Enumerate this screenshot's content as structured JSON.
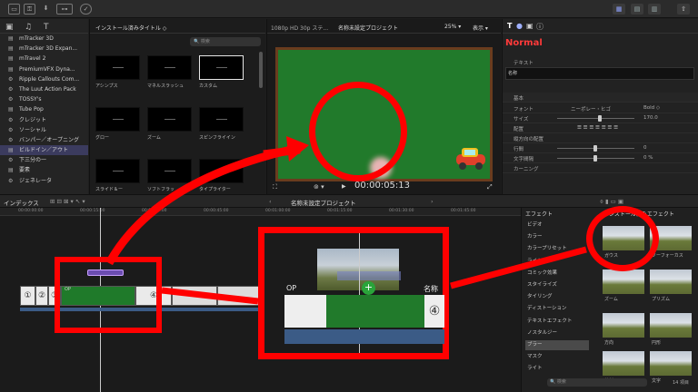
{
  "sidebar": {
    "items": [
      {
        "label": "mTracker 3D",
        "icon": "film-icon"
      },
      {
        "label": "mTracker 3D Expan...",
        "icon": "film-icon"
      },
      {
        "label": "mTravel 2",
        "icon": "film-icon"
      },
      {
        "label": "PremiumVFX Dyna...",
        "icon": "film-icon"
      },
      {
        "label": "Ripple Callouts Com...",
        "icon": "gear-icon"
      },
      {
        "label": "The Luut Action Pack",
        "icon": "gear-icon"
      },
      {
        "label": "TOSSY's",
        "icon": "gear-icon"
      },
      {
        "label": "Tube Pop",
        "icon": "film-icon"
      },
      {
        "label": "クレジット",
        "icon": "gear-icon"
      },
      {
        "label": "ソーシャル",
        "icon": "gear-icon"
      },
      {
        "label": "バンパー／オープニング",
        "icon": "gear-icon"
      },
      {
        "label": "ビルドイン／アウト",
        "icon": "film-icon"
      },
      {
        "label": "下三分の一",
        "icon": "gear-icon"
      },
      {
        "label": "要素",
        "icon": "film-icon"
      },
      {
        "label": "ジェネレータ",
        "icon": "gear-icon"
      }
    ]
  },
  "browser": {
    "title": "インストール済みタイトル ◇",
    "search_placeholder": "検索",
    "thumbs": [
      {
        "label": "アシンプス"
      },
      {
        "label": "マネルスラッシュ"
      },
      {
        "label": "カスタム"
      },
      {
        "label": "グロー"
      },
      {
        "label": "ズーム"
      },
      {
        "label": "スピンフライイン"
      },
      {
        "label": "スライド＆ー"
      },
      {
        "label": "ソフトフラッ"
      },
      {
        "label": "タイプライター"
      }
    ]
  },
  "viewer": {
    "format": "1080p HD 30p ステ...",
    "project": "名称未設定プロジェクト",
    "zoom": "25% ▾",
    "display": "表示 ▾",
    "timecode": "00:00:05:13"
  },
  "inspector": {
    "style": "Normal",
    "title_field": "名称",
    "section_text": "テキスト",
    "section_basic": "基本",
    "rows": [
      {
        "label": "フォント",
        "value": "ニーポレー・ヒゴ"
      },
      {
        "label": "サイズ",
        "value": "170.0"
      },
      {
        "label": "配置",
        "value": ""
      },
      {
        "label": "縦方向の配置",
        "value": ""
      },
      {
        "label": "行間",
        "value": "0"
      },
      {
        "label": "文字間隔",
        "value": "0 %"
      },
      {
        "label": "カーニング",
        "value": ""
      }
    ],
    "bold": "Bold ◇"
  },
  "toolbar": {
    "index": "インデックス",
    "project": "名称未設定プロジェクト",
    "effects": "エフェクト",
    "installed": "インストール済みエフェクト"
  },
  "ruler": [
    "00:00:00:00",
    "00:00:15:00",
    "00:00:30:00",
    "00:00:45:00",
    "00:01:00:00",
    "00:01:15:00",
    "00:01:30:00",
    "00:01:45:00"
  ],
  "clips": {
    "op": "OP",
    "name": "名称未",
    "number": "④",
    "circle1": "①",
    "circle2": "②",
    "circle3": "③"
  },
  "effects": {
    "categories": [
      "ビデオ",
      "カラー",
      "カラープリセット",
      "ライト",
      "コミック効果",
      "スタイライズ",
      "タイリング",
      "ディストーション",
      "テキストエフェクト",
      "ノスタルジー",
      "ブラー",
      "マスク",
      "ライト"
    ],
    "selected": "ブラー",
    "thumbs": [
      {
        "label": "ガウス"
      },
      {
        "label": "ソーフォーカス"
      },
      {
        "label": "ズーム"
      },
      {
        "label": "プリズム"
      },
      {
        "label": "方向"
      },
      {
        "label": "円形"
      },
      {
        "label": "放射"
      },
      {
        "label": "文字"
      }
    ],
    "search_placeholder": "検索",
    "count": "14 項目"
  }
}
